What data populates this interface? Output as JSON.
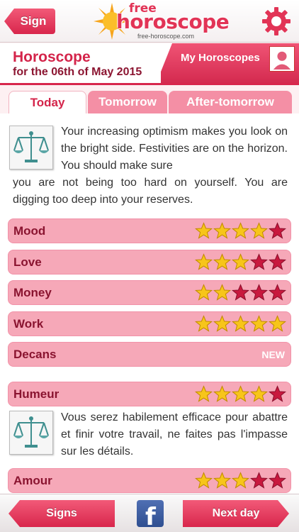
{
  "topbar": {
    "sign_label": "Sign",
    "logo": {
      "free": "free",
      "name": "horoscope",
      "site": "free-horoscope.com"
    }
  },
  "header": {
    "title": "Horoscope",
    "subtitle": "for the 06th of May 2015",
    "my_horoscopes_label": "My Horoscopes"
  },
  "tabs": [
    {
      "label": "Today",
      "active": true
    },
    {
      "label": "Tomorrow",
      "active": false
    },
    {
      "label": "After-tomorrow",
      "active": false
    }
  ],
  "horoscope": {
    "text_line1": "Your increasing optimism makes you look on the bright side. Festivities are on the horizon. You should make sure",
    "text_line2": "you are not being too hard on yourself. You are digging too deep into your reserves."
  },
  "ratings": [
    {
      "label": "Mood",
      "stars": 4,
      "max": 5
    },
    {
      "label": "Love",
      "stars": 3,
      "max": 5
    },
    {
      "label": "Money",
      "stars": 2,
      "max": 5
    },
    {
      "label": "Work",
      "stars": 5,
      "max": 5
    }
  ],
  "decans": {
    "label": "Decans",
    "badge": "NEW"
  },
  "french": {
    "humeur": {
      "label": "Humeur",
      "stars": 4,
      "max": 5
    },
    "text": "Vous serez habilement efficace pour abattre et finir votre travail, ne faites pas l'impasse sur les détails.",
    "amour": {
      "label": "Amour",
      "stars": 3,
      "max": 5
    }
  },
  "bottombar": {
    "signs_label": "Signs",
    "next_label": "Next day"
  },
  "colors": {
    "accent": "#d8264c",
    "row_bg": "#f6a8b8",
    "star_on": "#f7c51a",
    "star_off": "#c8183e"
  }
}
